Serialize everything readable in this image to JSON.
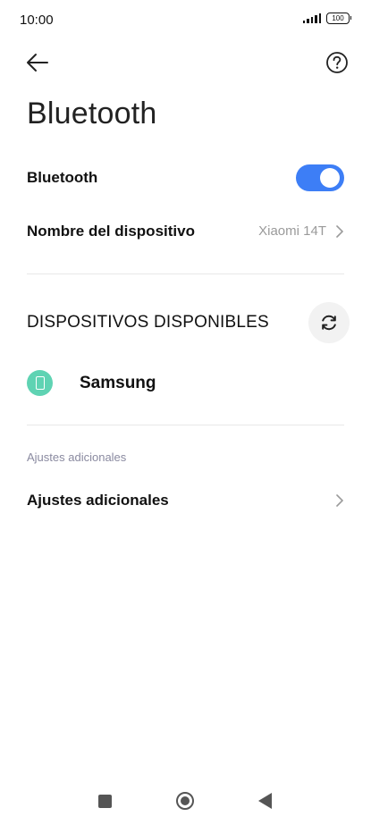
{
  "status_bar": {
    "time": "10:00",
    "battery": "100"
  },
  "header": {
    "back_icon": "arrow-left-icon",
    "help_icon": "question-circle-icon",
    "title": "Bluetooth"
  },
  "bluetooth_row": {
    "label": "Bluetooth",
    "enabled": true,
    "toggle_color": "#3d7ef6"
  },
  "device_name_row": {
    "label": "Nombre del dispositivo",
    "value": "Xiaomi 14T"
  },
  "available_devices": {
    "title": "DISPOSITIVOS DISPONIBLES",
    "refresh_icon": "refresh-icon",
    "devices": [
      {
        "name": "Samsung",
        "icon": "phone-icon",
        "icon_color": "#5fd3b3"
      }
    ]
  },
  "additional": {
    "section_header": "Ajustes adicionales",
    "row_label": "Ajustes adicionales"
  },
  "nav_bar": {
    "recents_icon": "square-icon",
    "home_icon": "home-circle-icon",
    "back_icon": "triangle-back-icon"
  }
}
